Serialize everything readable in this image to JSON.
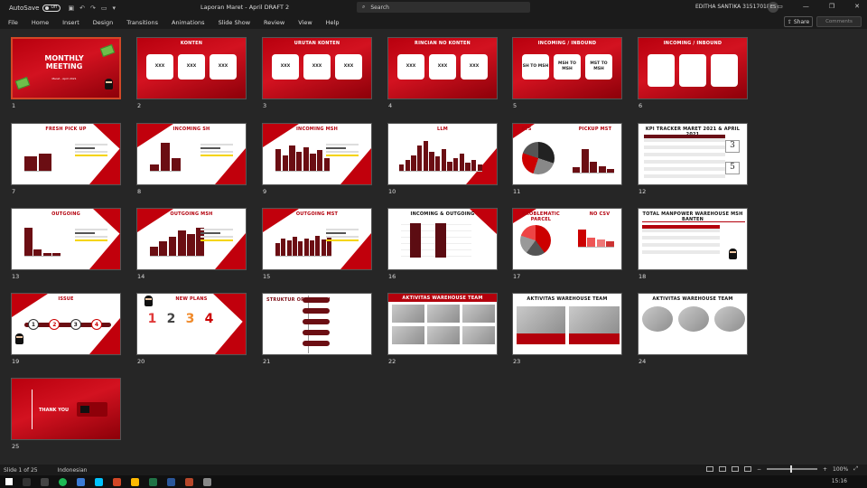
{
  "titlebar": {
    "autosave_label": "AutoSave",
    "autosave_state": "Off",
    "document_title": "Laporan Maret - April DRAFT 2",
    "search_placeholder": "Search",
    "user_name": "EDITHA SANTIKA 315170184",
    "user_initials": "ES"
  },
  "ribbon": {
    "tabs": [
      "File",
      "Home",
      "Insert",
      "Design",
      "Transitions",
      "Animations",
      "Slide Show",
      "Review",
      "View",
      "Help"
    ],
    "share_label": "Share",
    "comments_label": "Comments"
  },
  "slides": [
    {
      "num": "1",
      "title": "MONTHLY MEETING",
      "subtitle": "Maret - April 2021"
    },
    {
      "num": "2",
      "title": "KONTEN",
      "cards": [
        "XXX",
        "XXX",
        "XXX"
      ]
    },
    {
      "num": "3",
      "title": "URUTAN KONTEN",
      "cards": [
        "XXX",
        "XXX",
        "XXX"
      ]
    },
    {
      "num": "4",
      "title": "RINCIAN NO KONTEN",
      "cards": [
        "XXX",
        "XXX",
        "XXX"
      ]
    },
    {
      "num": "5",
      "title": "INCOMING / INBOUND",
      "cards": [
        "SH TO MSH",
        "MSH TO MSH",
        "MST TO MSH"
      ]
    },
    {
      "num": "6",
      "title": "INCOMING / INBOUND"
    },
    {
      "num": "7",
      "title": "FRESH PICK UP"
    },
    {
      "num": "8",
      "title": "INCOMING SH"
    },
    {
      "num": "9",
      "title": "INCOMING MSH"
    },
    {
      "num": "10",
      "title": "LLM"
    },
    {
      "num": "11",
      "title": "RTS",
      "title2": "PICKUP MST"
    },
    {
      "num": "12",
      "title": "KPI TRACKER MARET 2021 & APRIL 2021",
      "big1": "3",
      "big2": "5"
    },
    {
      "num": "13",
      "title": "OUTGOING"
    },
    {
      "num": "14",
      "title": "OUTGOING MSH"
    },
    {
      "num": "15",
      "title": "OUTGOING MST"
    },
    {
      "num": "16",
      "title": "INCOMING & OUTGOING"
    },
    {
      "num": "17",
      "title": "PROBLEMATIC PARCEL",
      "title2": "NO CSV"
    },
    {
      "num": "18",
      "title": "TOTAL MANPOWER WAREHOUSE MSH BANTEN"
    },
    {
      "num": "19",
      "title": "ISSUE",
      "steps": [
        "1",
        "2",
        "3",
        "4"
      ]
    },
    {
      "num": "20",
      "title": "NEW PLANS",
      "steps": [
        "1",
        "2",
        "3",
        "4"
      ]
    },
    {
      "num": "21",
      "title": "STRUKTUR ORGANISASI"
    },
    {
      "num": "22",
      "title": "AKTIVITAS WAREHOUSE TEAM"
    },
    {
      "num": "23",
      "title": "AKTIVITAS WAREHOUSE TEAM"
    },
    {
      "num": "24",
      "title": "AKTIVITAS WAREHOUSE TEAM"
    },
    {
      "num": "25",
      "title": "THANK YOU"
    }
  ],
  "statusbar": {
    "slide_count": "Slide 1 of 25",
    "language": "Indonesian",
    "zoom": "100%"
  },
  "taskbar": {
    "time": "15:16"
  },
  "colors": {
    "accent": "#d24726",
    "slide_red": "#c1000c",
    "app_bg": "#262626"
  }
}
